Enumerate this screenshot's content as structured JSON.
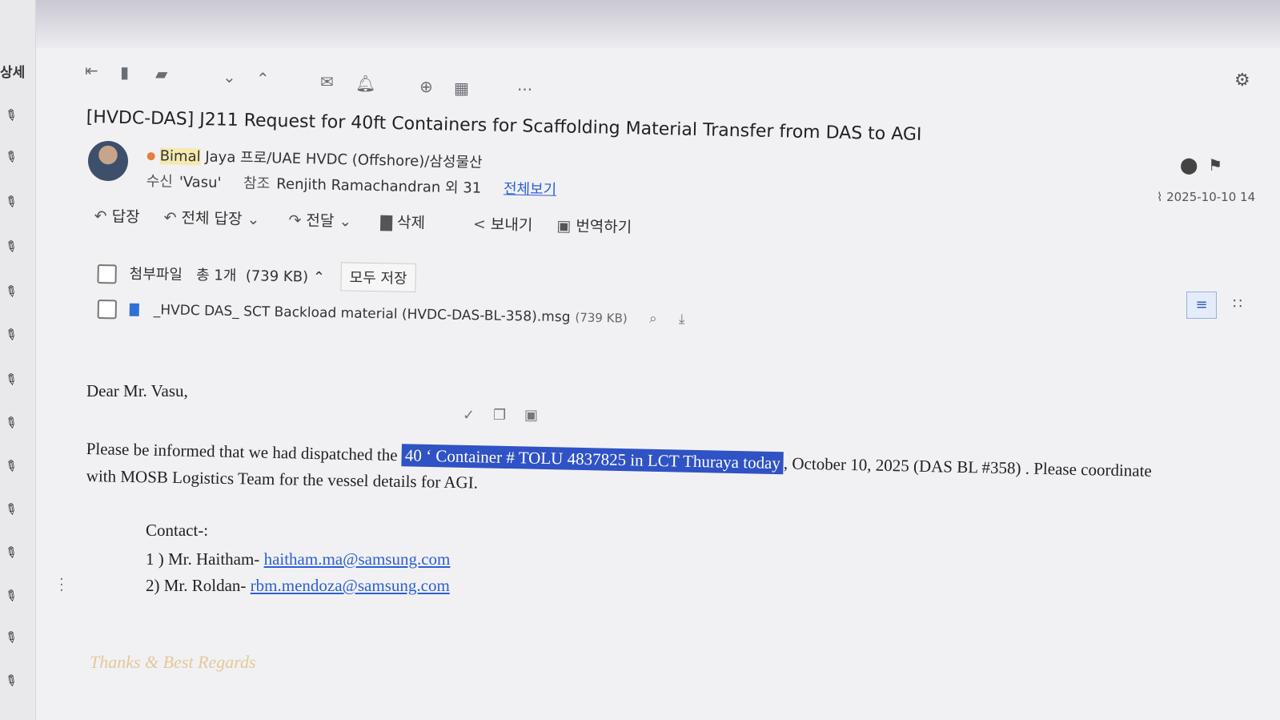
{
  "sidebar": {
    "top_label": "상세"
  },
  "toolbar": {
    "icons": [
      "back-to-start-icon",
      "archive-icon",
      "move-to-folder-icon",
      "chevron-down-icon",
      "chevron-up-icon",
      "mail-icon",
      "bell-icon",
      "zoom-icon",
      "calendar-icon",
      "more-icon",
      "gear-icon"
    ],
    "more": "···"
  },
  "email": {
    "subject": "[HVDC-DAS] J211 Request for 40ft Containers for Scaffolding Material Transfer from DAS to AGI",
    "sender_first": "Bimal",
    "sender_rest": " Jaya  프로/UAE HVDC (Offshore)/삼성물산",
    "to_label": "수신",
    "to": "'Vasu'",
    "cc_label": "참조",
    "cc": "Renjith Ramachandran 외 31",
    "view_all": "전체보기",
    "date": "2025-10-10 14"
  },
  "actions": {
    "reply": "답장",
    "reply_all": "전체 답장",
    "forward": "전달",
    "delete": "삭제",
    "send": "보내기",
    "translate": "번역하기"
  },
  "attachments": {
    "label": "첨부파일",
    "count": "총 1개",
    "total_size": "(739 KB)",
    "save_all": "모두 저장",
    "file_name": "_HVDC DAS_ SCT Backload material (HVDC-DAS-BL-358).msg",
    "file_size": "(739 KB)"
  },
  "body": {
    "greeting": "Dear Mr. Vasu,",
    "line1_pre": "Please be informed that we had dispatched the ",
    "line1_sel": "40 ‘ Container # TOLU 4837825 in LCT Thuraya today",
    "line1_post": ", October 10, 2025 (DAS BL #358) . Please coordinate",
    "line2": "with MOSB Logistics Team for  the vessel details for AGI.",
    "contact_label": "Contact-:",
    "c1_prefix": "1 )  Mr. Haitham- ",
    "c1_email": "haitham.ma@samsung.com",
    "c2_prefix": "2)  Mr.  Roldan- ",
    "c2_email": "rbm.mendoza@samsung.com",
    "signature": "Thanks & Best Regards"
  },
  "colors": {
    "selection": "#2f52c4",
    "link": "#2b5fd6",
    "presence": "#e67e3b"
  }
}
